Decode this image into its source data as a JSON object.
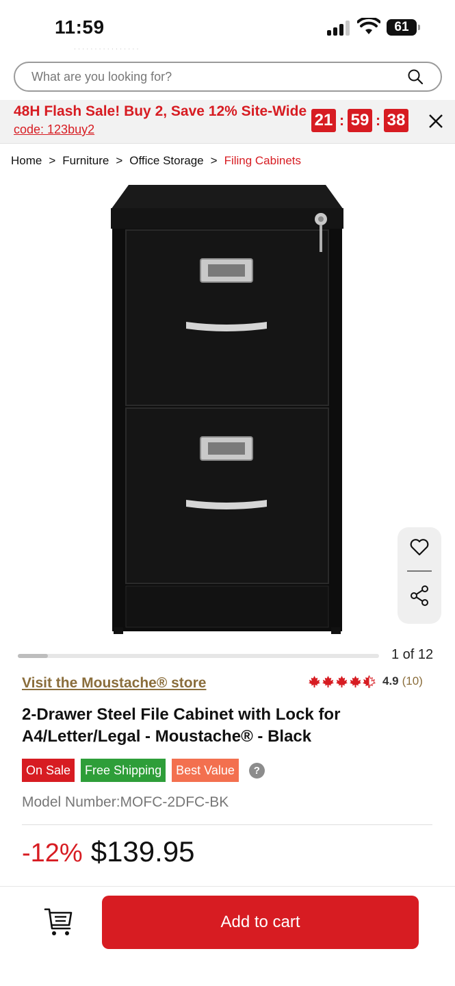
{
  "status_bar": {
    "time": "11:59",
    "battery": "61"
  },
  "search": {
    "placeholder": "What are you looking for?"
  },
  "flash_sale": {
    "title": "48H Flash Sale! Buy 2, Save 12% Site-Wide",
    "code": "code: 123buy2",
    "timer": {
      "hours": "21",
      "minutes": "59",
      "seconds": "38"
    },
    "accent": "#d71c22"
  },
  "breadcrumb": {
    "items": [
      "Home",
      "Furniture",
      "Office Storage"
    ],
    "current": "Filing Cabinets",
    "separator": ">"
  },
  "gallery": {
    "counter": "1 of 12",
    "progress_fraction": 0.0833
  },
  "product": {
    "store_link": "Visit the Moustache® store",
    "rating": {
      "score": "4.9",
      "count": "(10)",
      "stars_filled": 4.5
    },
    "title": "2-Drawer Steel File Cabinet with Lock for A4/Letter/Legal - Moustache® - Black",
    "badges": {
      "sale": "On Sale",
      "shipping": "Free Shipping",
      "value": "Best Value",
      "help": "?"
    },
    "model": "Model Number:MOFC-2DFC-BK",
    "discount": "-12%",
    "price": "$139.95"
  },
  "bottom_bar": {
    "add_to_cart": "Add to cart"
  },
  "colors": {
    "brand_red": "#d71c22",
    "success_green": "#2e9e39",
    "value_orange": "#f3704f",
    "store_gold": "#8a6d3b"
  },
  "icons": [
    "search-icon",
    "close-icon",
    "heart-icon",
    "share-icon",
    "maple-leaf-icon",
    "cart-list-icon",
    "lock-icon"
  ]
}
